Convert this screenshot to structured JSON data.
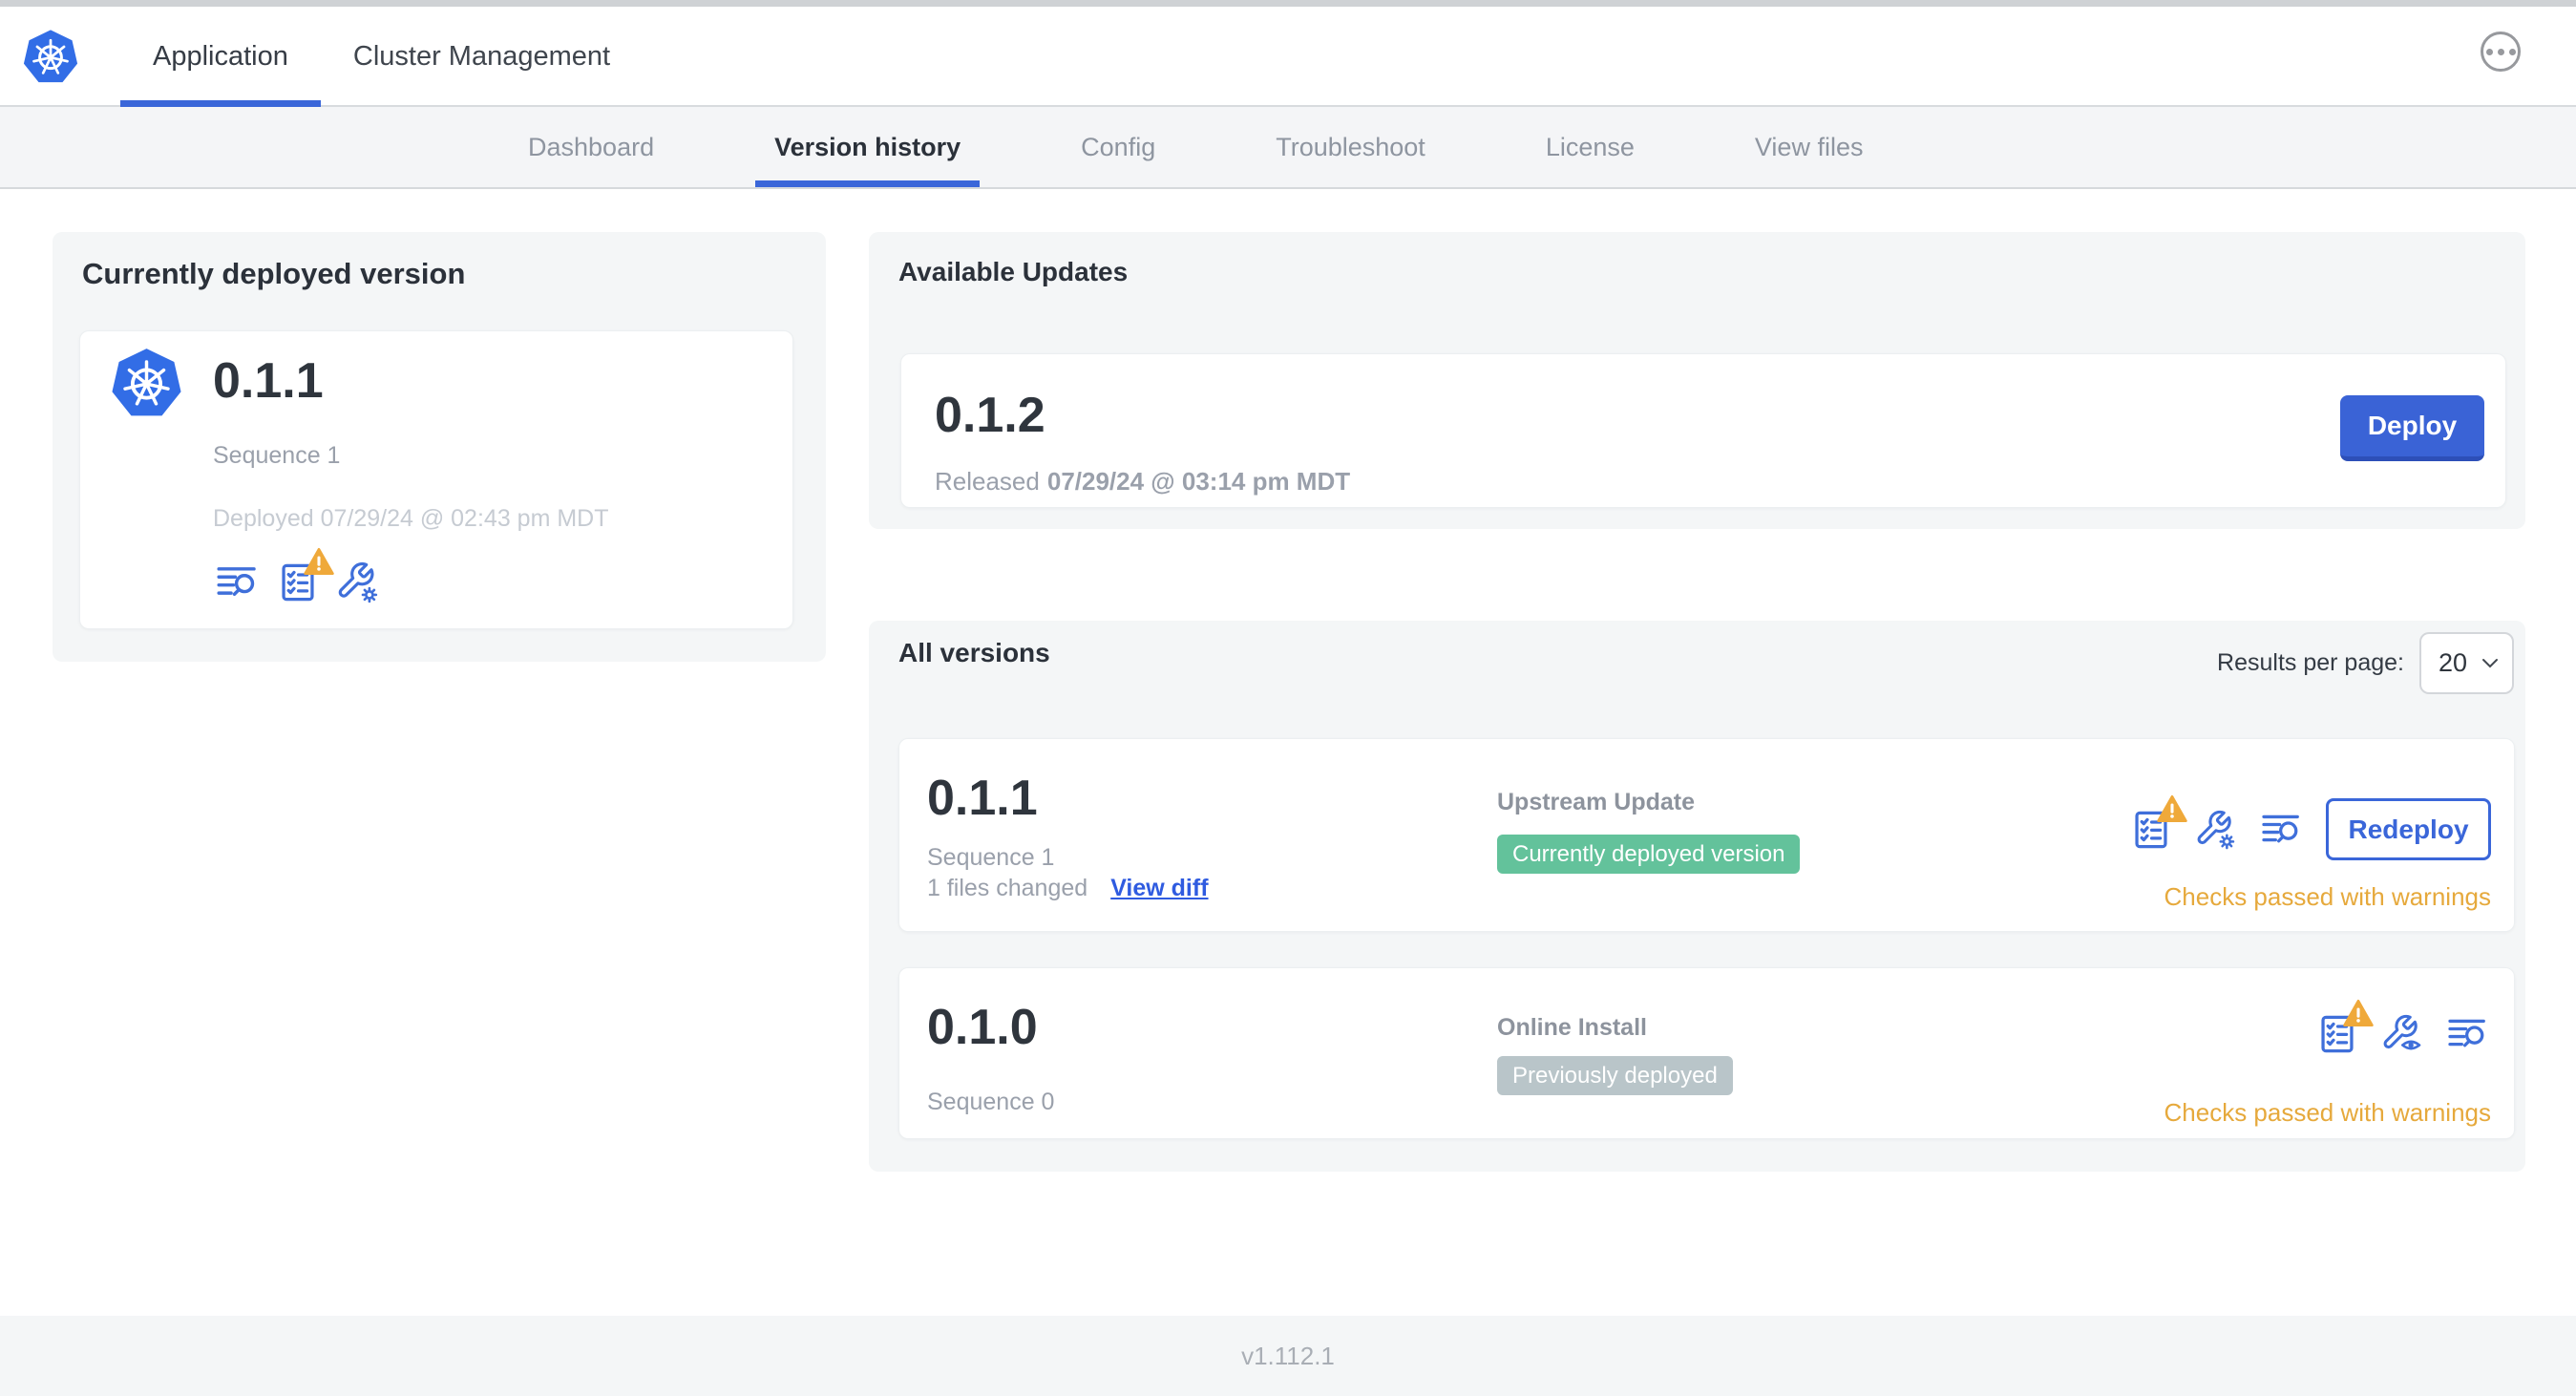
{
  "header": {
    "tabs": [
      {
        "label": "Application"
      },
      {
        "label": "Cluster Management"
      }
    ],
    "menu_icon": "ellipsis-menu-icon"
  },
  "subnav": {
    "tabs": [
      {
        "label": "Dashboard"
      },
      {
        "label": "Version history"
      },
      {
        "label": "Config"
      },
      {
        "label": "Troubleshoot"
      },
      {
        "label": "License"
      },
      {
        "label": "View files"
      }
    ]
  },
  "current": {
    "title": "Currently deployed version",
    "version": "0.1.1",
    "sequence": "Sequence 1",
    "deployed": "Deployed 07/29/24 @ 02:43 pm MDT",
    "icons": [
      "logs-icon",
      "preflight-checks-warning-icon",
      "edit-config-icon"
    ]
  },
  "updates": {
    "title": "Available Updates",
    "version": "0.1.2",
    "released_prefix": "Released",
    "released_date": "07/29/24 @ 03:14 pm MDT",
    "deploy_label": "Deploy"
  },
  "versions": {
    "title": "All versions",
    "results_label": "Results per page:",
    "results_value": "20",
    "rows": [
      {
        "version": "0.1.1",
        "sequence": "Sequence 1",
        "files_changed": "1 files changed",
        "diff_label": "View diff",
        "source": "Upstream Update",
        "badge": "Currently deployed version",
        "badge_color": "#63c29b",
        "status": "Checks passed with warnings",
        "action_label": "Redeploy",
        "icons": [
          "preflight-checks-warning-icon",
          "edit-config-icon",
          "logs-icon"
        ]
      },
      {
        "version": "0.1.0",
        "sequence": "Sequence 0",
        "source": "Online Install",
        "badge": "Previously deployed",
        "badge_color": "#b9c5c9",
        "status": "Checks passed with warnings",
        "icons": [
          "preflight-checks-warning-icon",
          "view-config-icon",
          "logs-icon"
        ]
      }
    ]
  },
  "footer": {
    "app_version": "v1.112.1"
  },
  "colors": {
    "accent_blue": "#3a66d9",
    "kubernetes_blue": "#326de6",
    "warning_amber": "#efa93a",
    "warning_text": "#e6a93c",
    "badge_green": "#63c29b",
    "badge_gray": "#b9c5c9",
    "panel_gray": "#f4f6f7"
  }
}
